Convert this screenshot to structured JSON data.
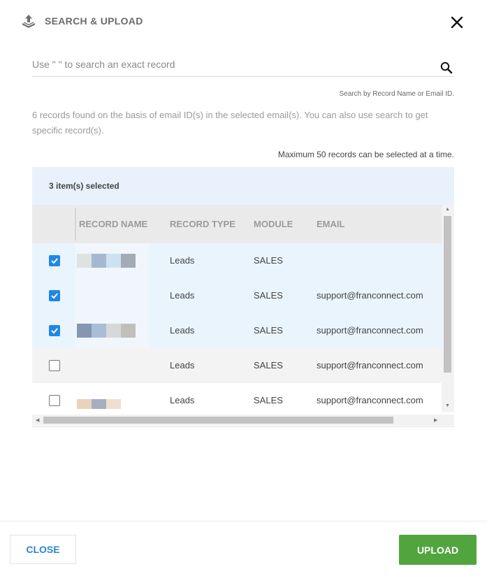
{
  "header": {
    "title": "SEARCH & UPLOAD",
    "icon": "upload-icon",
    "close_icon": "close-icon"
  },
  "search": {
    "placeholder": "Use \" \" to search an exact record",
    "value": "",
    "hint": "Search by Record Name or Email ID.",
    "icon": "search-icon"
  },
  "info_text": "6 records found on the basis of email ID(s) in the selected email(s). You can also use search to get specific record(s).",
  "max_note": "Maximum 50 records can be selected at a time.",
  "selection_bar": {
    "label": "3 item(s) selected"
  },
  "table": {
    "columns": [
      "RECORD NAME",
      "RECORD TYPE",
      "MODULE",
      "EMAIL"
    ],
    "rows": [
      {
        "checked": true,
        "record_type": "Leads",
        "module": "SALES",
        "email": ""
      },
      {
        "checked": true,
        "record_type": "Leads",
        "module": "SALES",
        "email": "support@franconnect.com"
      },
      {
        "checked": true,
        "record_type": "Leads",
        "module": "SALES",
        "email": "support@franconnect.com"
      },
      {
        "checked": false,
        "record_type": "Leads",
        "module": "SALES",
        "email": "support@franconnect.com"
      },
      {
        "checked": false,
        "record_type": "Leads",
        "module": "SALES",
        "email": "support@franconnect.com"
      }
    ]
  },
  "footer": {
    "close_label": "CLOSE",
    "upload_label": "UPLOAD"
  },
  "colors": {
    "accent_blue": "#1e88e5",
    "upload_green": "#52a43f",
    "selection_bg": "#e8f1fc",
    "close_text": "#2a86d6"
  }
}
